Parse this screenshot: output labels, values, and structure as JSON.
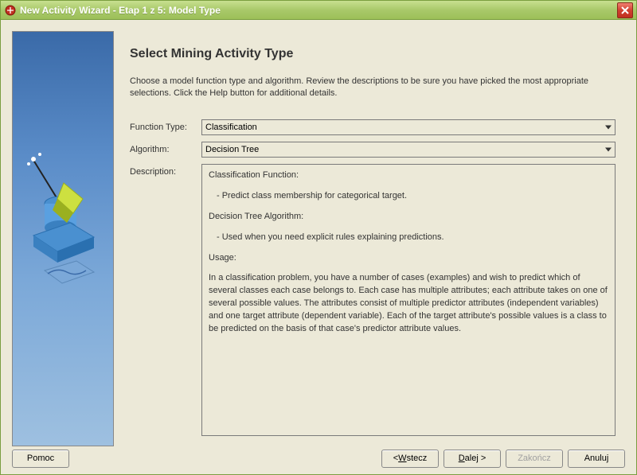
{
  "window": {
    "title": "New Activity Wizard - Etap 1 z 5: Model Type"
  },
  "page": {
    "heading": "Select Mining Activity Type",
    "intro": "Choose a model function type and algorithm.  Review the descriptions to be sure you have picked the most appropriate selections. Click the Help button for additional details."
  },
  "form": {
    "function_label": "Function Type:",
    "function_value": "Classification",
    "algorithm_label": "Algorithm:",
    "algorithm_value": "Decision Tree",
    "description_label": "Description:"
  },
  "description": {
    "h1": "Classification Function:",
    "l1": "- Predict class membership for categorical target.",
    "h2": "Decision Tree Algorithm:",
    "l2": "- Used when you need explicit rules explaining predictions.",
    "h3": "Usage:",
    "body": "In a classification problem, you have a number of cases (examples) and wish to predict which of several classes each case belongs to. Each case has multiple attributes; each attribute takes on one of several possible values. The attributes consist of multiple predictor attributes (independent variables) and one target attribute (dependent variable). Each of the target attribute's possible values is a class to be predicted on the basis of that case's predictor attribute values."
  },
  "buttons": {
    "help": "Pomoc",
    "back_prefix": "< ",
    "back_u": "W",
    "back_rest": "stecz",
    "next_u": "D",
    "next_rest": "alej >",
    "finish": "Zakończ",
    "cancel": "Anuluj"
  }
}
